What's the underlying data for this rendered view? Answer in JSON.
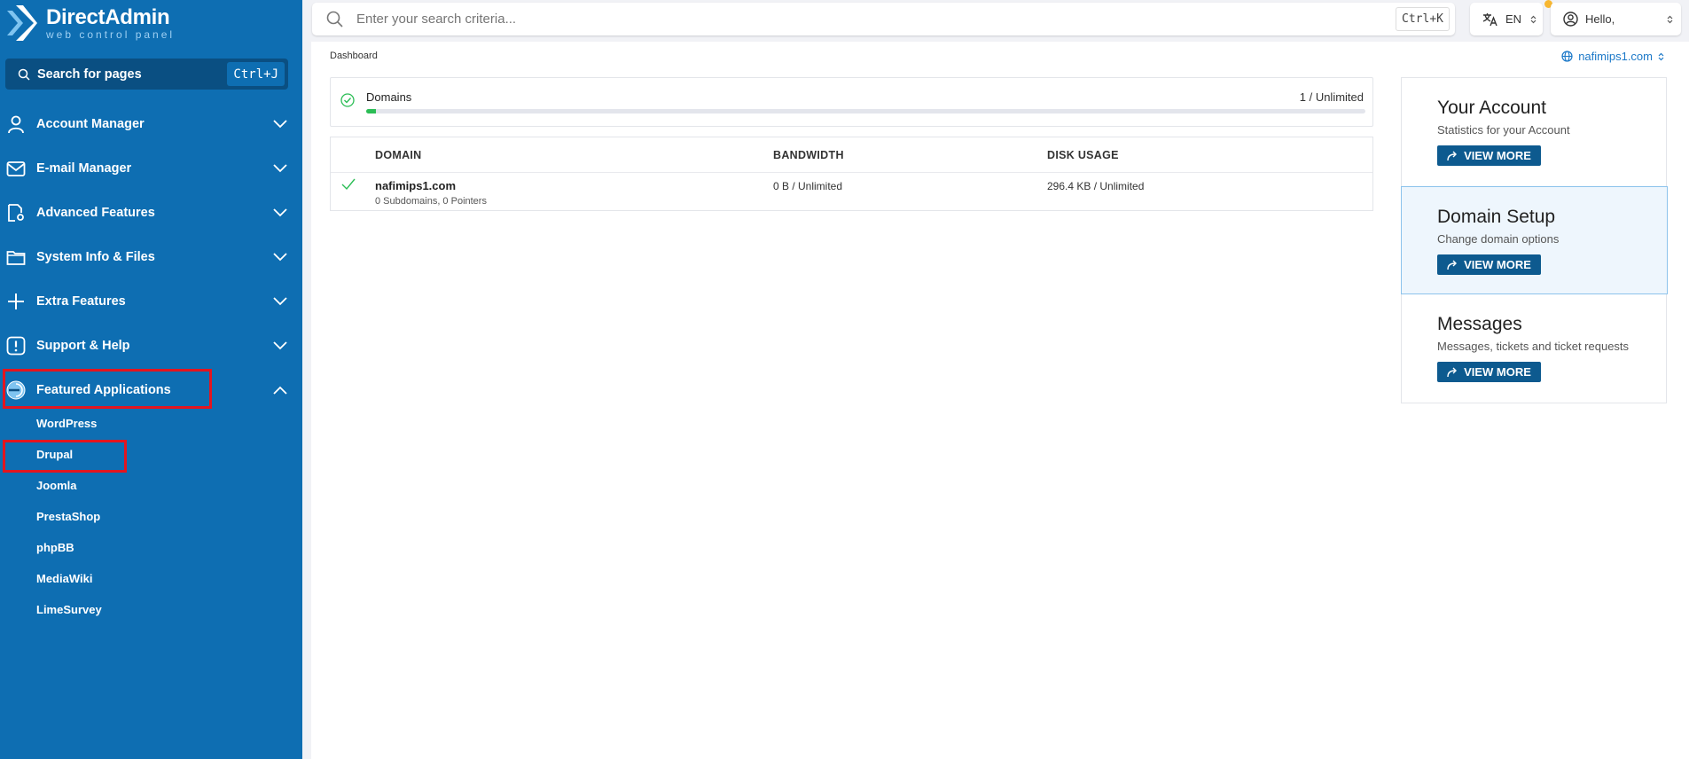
{
  "brand": {
    "title": "DirectAdmin",
    "subtitle": "web control panel"
  },
  "sidebar": {
    "search_label": "Search for pages",
    "search_shortcut": "Ctrl+J",
    "menu": [
      {
        "label": "Account Manager",
        "icon": "user-icon"
      },
      {
        "label": "E-mail Manager",
        "icon": "mail-icon"
      },
      {
        "label": "Advanced Features",
        "icon": "settings-doc-icon"
      },
      {
        "label": "System Info & Files",
        "icon": "folder-icon"
      },
      {
        "label": "Extra Features",
        "icon": "plus-icon"
      },
      {
        "label": "Support & Help",
        "icon": "alert-icon"
      },
      {
        "label": "Featured Applications",
        "icon": "apps-icon",
        "expanded": true
      }
    ],
    "submenu": [
      "WordPress",
      "Drupal",
      "Joomla",
      "PrestaShop",
      "phpBB",
      "MediaWiki",
      "LimeSurvey"
    ]
  },
  "topbar": {
    "search_placeholder": "Enter your search criteria...",
    "search_shortcut": "Ctrl+K",
    "language": "EN",
    "greeting": "Hello,"
  },
  "content": {
    "breadcrumb": "Dashboard",
    "selected_domain": "nafimips1.com",
    "domains_usage": {
      "label": "Domains",
      "value": "1 / Unlimited",
      "fill_fraction": 0.01
    },
    "table": {
      "headers": [
        "DOMAIN",
        "BANDWIDTH",
        "DISK USAGE"
      ],
      "rows": [
        {
          "domain": "nafimips1.com",
          "details": "0 Subdomains, 0 Pointers",
          "bandwidth": "0 B / Unlimited",
          "disk": "296.4 KB / Unlimited"
        }
      ]
    },
    "cards": [
      {
        "title": "Your Account",
        "desc": "Statistics for your Account",
        "button": "VIEW MORE"
      },
      {
        "title": "Domain Setup",
        "desc": "Change domain options",
        "button": "VIEW MORE"
      },
      {
        "title": "Messages",
        "desc": "Messages, tickets and ticket requests",
        "button": "VIEW MORE"
      }
    ]
  },
  "colors": {
    "sidebar": "#0e6eb2",
    "accent": "#0d5a8f",
    "success": "#2bbd55",
    "highlight": "#e3151f"
  }
}
